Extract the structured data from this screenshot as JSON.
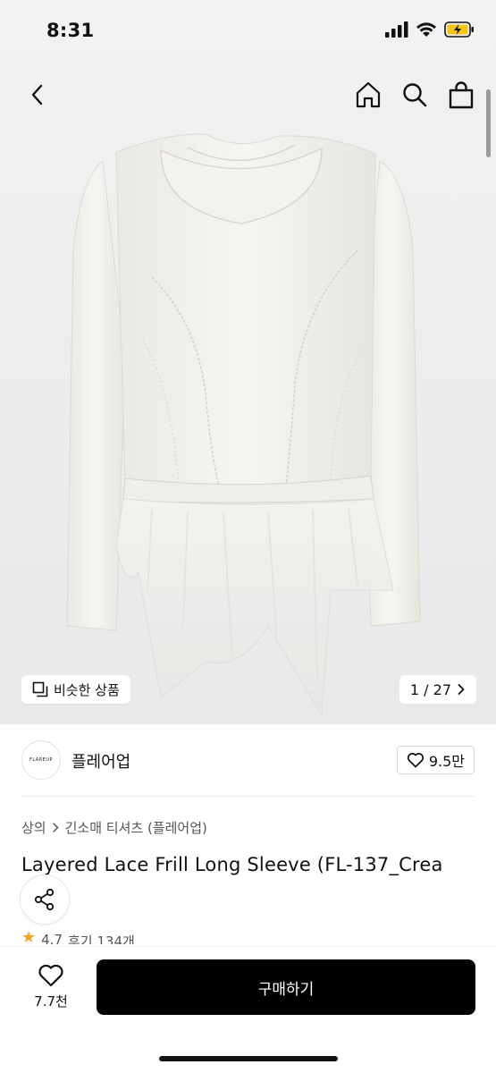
{
  "status": {
    "time": "8:31"
  },
  "icons": {
    "back": "chevron-left-icon",
    "home": "home-icon",
    "search": "search-icon",
    "cart": "shopping-bag-icon",
    "similar": "similar-products-icon",
    "share": "share-icon",
    "heart": "heart-icon",
    "star": "star-icon"
  },
  "gallery": {
    "similar_label": "비슷한 상품",
    "page_indicator": "1 / 27"
  },
  "brand": {
    "logo_text": "FLAREUP",
    "name": "플레어업",
    "like_count": "9.5만"
  },
  "product": {
    "breadcrumb": [
      "상의",
      "긴소매 티셔츠 (플레어업)"
    ],
    "title": "Layered Lace Frill Long Sleeve (FL-137_Crea",
    "rating": "4.7",
    "review_text": "후기 134개"
  },
  "bottom": {
    "wish_count": "7.7천",
    "buy_label": "구매하기"
  },
  "colors": {
    "accent": "#000000",
    "star": "#f2a623"
  }
}
